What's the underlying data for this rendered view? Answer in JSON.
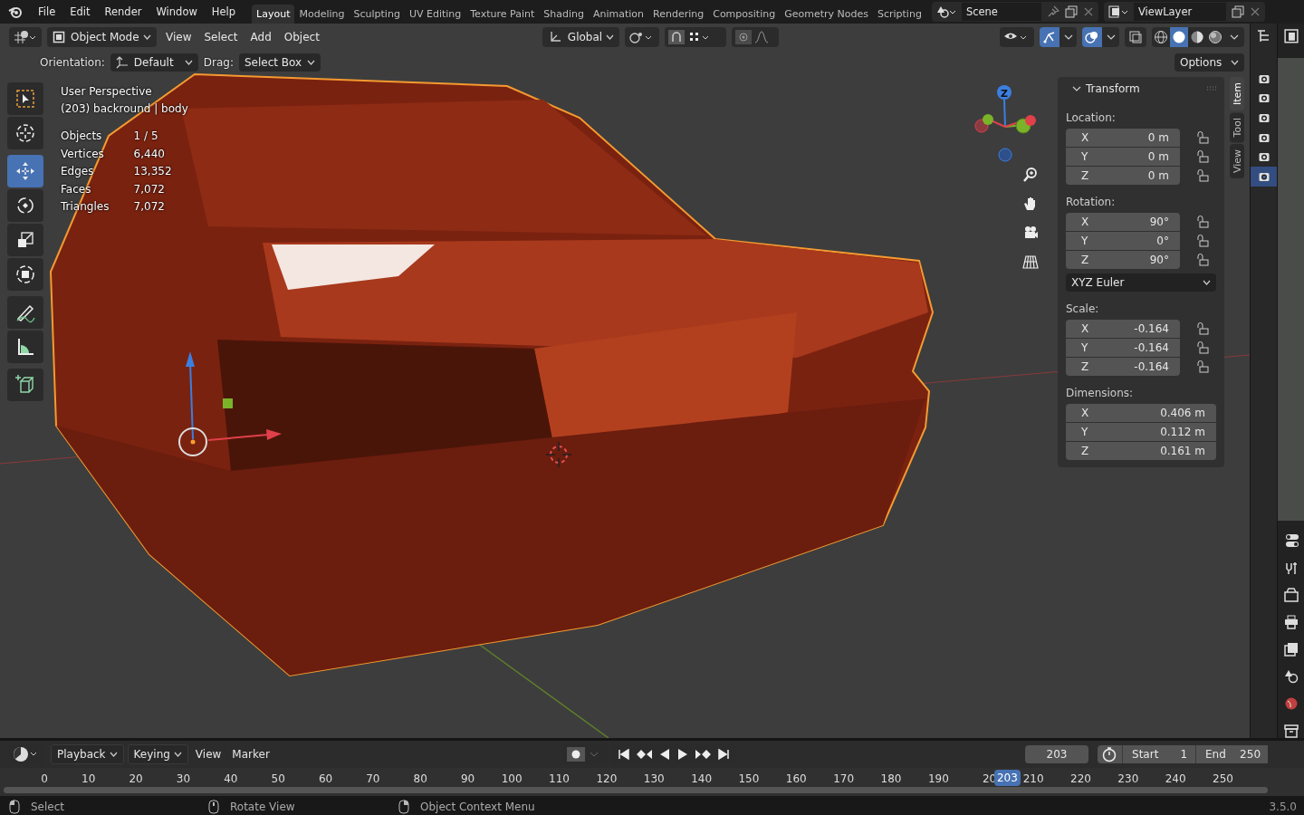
{
  "topbar": {
    "menus": [
      "File",
      "Edit",
      "Render",
      "Window",
      "Help"
    ],
    "workspaces": [
      {
        "label": "Layout",
        "selected": true
      },
      {
        "label": "Modeling",
        "selected": false
      },
      {
        "label": "Sculpting",
        "selected": false
      },
      {
        "label": "UV Editing",
        "selected": false
      },
      {
        "label": "Texture Paint",
        "selected": false
      },
      {
        "label": "Shading",
        "selected": false
      },
      {
        "label": "Animation",
        "selected": false
      },
      {
        "label": "Rendering",
        "selected": false
      },
      {
        "label": "Compositing",
        "selected": false
      },
      {
        "label": "Geometry Nodes",
        "selected": false
      },
      {
        "label": "Scripting",
        "selected": false
      }
    ],
    "scene": "Scene",
    "view_layer": "ViewLayer"
  },
  "header": {
    "mode": "Object Mode",
    "menus": [
      "View",
      "Select",
      "Add",
      "Object"
    ],
    "orientation": "Global",
    "options": "Options",
    "toggles": [
      {
        "kind": "gizmo",
        "on": true
      },
      {
        "kind": "overlay",
        "on": true
      }
    ],
    "shading": [
      {
        "kind": "wireframe",
        "selected": false
      },
      {
        "kind": "solid",
        "selected": true
      },
      {
        "kind": "material",
        "selected": false
      },
      {
        "kind": "rendered",
        "selected": false
      }
    ]
  },
  "tool_settings": {
    "orientation_label": "Orientation:",
    "orientation": "Default",
    "drag_label": "Drag:",
    "drag": "Select Box"
  },
  "toolbar": [
    {
      "kind": "select",
      "selected": false
    },
    {
      "kind": "cursor",
      "selected": false
    },
    {
      "kind": "move",
      "selected": true
    },
    {
      "kind": "rotate",
      "selected": false
    },
    {
      "kind": "scale",
      "selected": false
    },
    {
      "kind": "transform",
      "selected": false
    },
    {
      "kind": "annotate",
      "selected": false
    },
    {
      "kind": "measure",
      "selected": false
    },
    {
      "kind": "add-cube",
      "selected": false
    }
  ],
  "overlay": {
    "title": "User Perspective",
    "object": "(203) backround | body",
    "stats": [
      {
        "label": "Objects",
        "value": "1 / 5"
      },
      {
        "label": "Vertices",
        "value": "6,440"
      },
      {
        "label": "Edges",
        "value": "13,352"
      },
      {
        "label": "Faces",
        "value": "7,072"
      },
      {
        "label": "Triangles",
        "value": "7,072"
      }
    ]
  },
  "gizmo_label": "Z",
  "sidebar": {
    "panel": "Transform",
    "expanded": true,
    "tabs": [
      {
        "label": "Item",
        "selected": true
      },
      {
        "label": "Tool",
        "selected": false
      },
      {
        "label": "View",
        "selected": false
      }
    ],
    "groups": [
      {
        "title": "Location:",
        "fields": [
          {
            "axis": "X",
            "value": "0 m",
            "locked": false
          },
          {
            "axis": "Y",
            "value": "0 m",
            "locked": false
          },
          {
            "axis": "Z",
            "value": "0 m",
            "locked": false
          }
        ]
      },
      {
        "title": "Rotation:",
        "fields": [
          {
            "axis": "X",
            "value": "90°",
            "locked": false
          },
          {
            "axis": "Y",
            "value": "0°",
            "locked": false
          },
          {
            "axis": "Z",
            "value": "90°",
            "locked": false
          }
        ],
        "mode": "XYZ Euler"
      },
      {
        "title": "Scale:",
        "fields": [
          {
            "axis": "X",
            "value": "-0.164",
            "locked": false
          },
          {
            "axis": "Y",
            "value": "-0.164",
            "locked": false
          },
          {
            "axis": "Z",
            "value": "-0.164",
            "locked": false
          }
        ]
      },
      {
        "title": "Dimensions:",
        "fields": [
          {
            "axis": "X",
            "value": "0.406 m"
          },
          {
            "axis": "Y",
            "value": "0.112 m"
          },
          {
            "axis": "Z",
            "value": "0.161 m"
          }
        ]
      }
    ]
  },
  "outliner_rows": [
    {
      "selected": false
    },
    {
      "selected": false
    },
    {
      "selected": false
    },
    {
      "selected": false
    },
    {
      "selected": false
    },
    {
      "selected": true
    }
  ],
  "timeline": {
    "menus": [
      {
        "label": "Playback",
        "dropdown": true
      },
      {
        "label": "Keying",
        "dropdown": true
      },
      {
        "label": "View",
        "dropdown": false
      },
      {
        "label": "Marker",
        "dropdown": false
      }
    ],
    "current_frame": "203",
    "start_label": "Start",
    "start": "1",
    "end_label": "End",
    "end": "250",
    "ticks": [
      "0",
      "10",
      "20",
      "30",
      "40",
      "50",
      "60",
      "70",
      "80",
      "90",
      "100",
      "110",
      "120",
      "130",
      "140",
      "150",
      "160",
      "170",
      "180",
      "190",
      "20",
      "210",
      "220",
      "230",
      "240",
      "250"
    ],
    "playhead": {
      "label": "203",
      "level": 0.812
    }
  },
  "status_bar": {
    "hints": [
      {
        "kind": "left",
        "label": "Select"
      },
      {
        "kind": "middle",
        "label": "Rotate View"
      },
      {
        "kind": "right",
        "label": "Object Context Menu"
      }
    ],
    "version": "3.5.0"
  }
}
